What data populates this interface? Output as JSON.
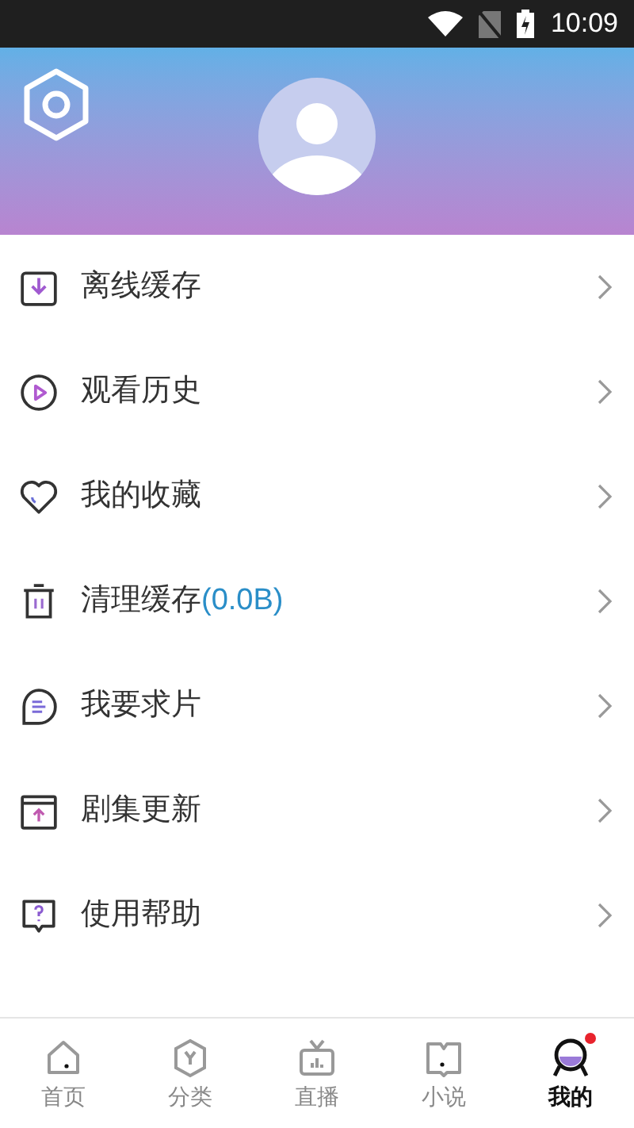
{
  "status_bar": {
    "time": "10:09"
  },
  "menu": [
    {
      "kind": "download",
      "label": "离线缓存"
    },
    {
      "kind": "history",
      "label": "观看历史"
    },
    {
      "kind": "favorite",
      "label": "我的收藏"
    },
    {
      "kind": "clear",
      "label": "清理缓存",
      "extra": "(0.0B)"
    },
    {
      "kind": "request",
      "label": "我要求片"
    },
    {
      "kind": "update",
      "label": "剧集更新"
    },
    {
      "kind": "help",
      "label": "使用帮助"
    }
  ],
  "tab_bar": [
    {
      "kind": "home",
      "label": "首页",
      "selected": false,
      "dot": false
    },
    {
      "kind": "category",
      "label": "分类",
      "selected": false,
      "dot": false
    },
    {
      "kind": "live",
      "label": "直播",
      "selected": false,
      "dot": false
    },
    {
      "kind": "novel",
      "label": "小说",
      "selected": false,
      "dot": false
    },
    {
      "kind": "mine",
      "label": "我的",
      "selected": true,
      "dot": true
    }
  ]
}
